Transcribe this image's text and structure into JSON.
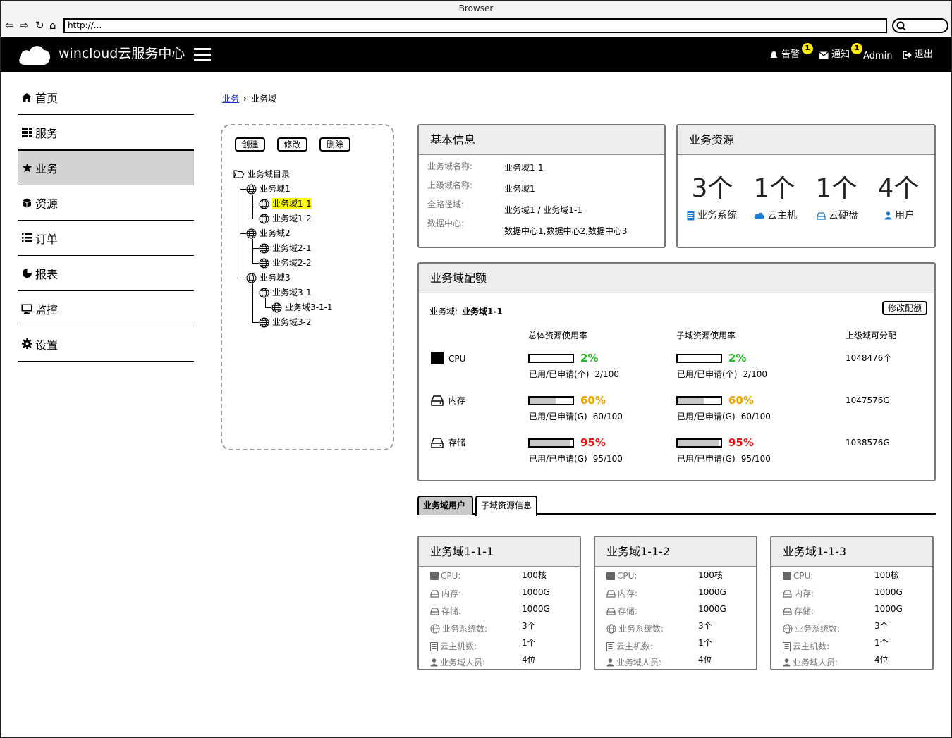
{
  "window": {
    "title": "Browser",
    "url": "http://..."
  },
  "header": {
    "brand": "wincloud云服务中心",
    "alerts_label": "告警",
    "alerts_count": "1",
    "notify_label": "通知",
    "notify_count": "1",
    "user": "Admin",
    "logout": "退出"
  },
  "sidebar": {
    "items": [
      {
        "label": "首页",
        "icon": "home-icon"
      },
      {
        "label": "服务",
        "icon": "grid-icon"
      },
      {
        "label": "业务",
        "icon": "star-icon",
        "active": true
      },
      {
        "label": "资源",
        "icon": "cube-icon"
      },
      {
        "label": "订单",
        "icon": "list-icon"
      },
      {
        "label": "报表",
        "icon": "pie-icon"
      },
      {
        "label": "监控",
        "icon": "monitor-icon"
      },
      {
        "label": "设置",
        "icon": "gear-icon"
      }
    ]
  },
  "breadcrumb": {
    "parent": "业务",
    "current": "业务域"
  },
  "tree": {
    "buttons": {
      "create": "创建",
      "edit": "修改",
      "delete": "删除"
    },
    "root": "业务域目录",
    "nodes": [
      "业务域1",
      "业务域1-1",
      "业务域1-2",
      "业务域2",
      "业务域2-1",
      "业务域2-2",
      "业务域3",
      "业务域3-1",
      "业务域3-1-1",
      "业务域3-2"
    ],
    "selected": "业务域1-1"
  },
  "basic": {
    "title": "基本信息",
    "labels": [
      "业务域名称:",
      "上级域名称:",
      "全路径域:",
      "数据中心:"
    ],
    "values": [
      "业务域1-1",
      "业务域1",
      "业务域1 / 业务域1-1",
      "数据中心1,数据中心2,数据中心3"
    ]
  },
  "resources": {
    "title": "业务资源",
    "items": [
      {
        "value": "3个",
        "label": "业务系统",
        "icon": "server-icon"
      },
      {
        "value": "1个",
        "label": "云主机",
        "icon": "cloud-icon"
      },
      {
        "value": "1个",
        "label": "云硬盘",
        "icon": "disk-icon"
      },
      {
        "value": "4个",
        "label": "用户",
        "icon": "user-icon"
      }
    ]
  },
  "quota": {
    "title": "业务域配额",
    "domain_label": "业务域:",
    "domain_value": "业务域1-1",
    "edit_button": "修改配额",
    "col_total": "总体资源使用率",
    "col_sub": "子域资源使用率",
    "col_parent": "上级域可分配",
    "rows": [
      {
        "name": "CPU",
        "icon": "cpu-icon",
        "pct": "2%",
        "fill": 0.02,
        "unit_label": "已用/已申请(个)",
        "ratio": "2/100",
        "parent": "1048476个",
        "color": "#22bb22"
      },
      {
        "name": "内存",
        "icon": "memory-icon",
        "pct": "60%",
        "fill": 0.6,
        "unit_label": "已用/已申请(G)",
        "ratio": "60/100",
        "parent": "1047576G",
        "color": "#f0a000"
      },
      {
        "name": "存储",
        "icon": "storage-icon",
        "pct": "95%",
        "fill": 0.95,
        "unit_label": "已用/已申请(G)",
        "ratio": "95/100",
        "parent": "1038576G",
        "color": "#ee1111"
      }
    ]
  },
  "tabs": [
    "业务域用户",
    "子域资源信息"
  ],
  "cards": [
    {
      "title": "业务域1-1-1",
      "labels": [
        "CPU:",
        "内存:",
        "存储:",
        "业务系统数:",
        "云主机数:",
        "业务域人员:"
      ],
      "values": [
        "100核",
        "1000G",
        "1000G",
        "3个",
        "1个",
        "4位"
      ]
    },
    {
      "title": "业务域1-1-2",
      "labels": [
        "CPU:",
        "内存:",
        "存储:",
        "业务系统数:",
        "云主机数:",
        "业务域人员:"
      ],
      "values": [
        "100核",
        "1000G",
        "1000G",
        "3个",
        "1个",
        "4位"
      ]
    },
    {
      "title": "业务域1-1-3",
      "labels": [
        "CPU:",
        "内存:",
        "存储:",
        "业务系统数:",
        "云主机数:",
        "业务域人员:"
      ],
      "values": [
        "100核",
        "1000G",
        "1000G",
        "3个",
        "1个",
        "4位"
      ]
    }
  ]
}
